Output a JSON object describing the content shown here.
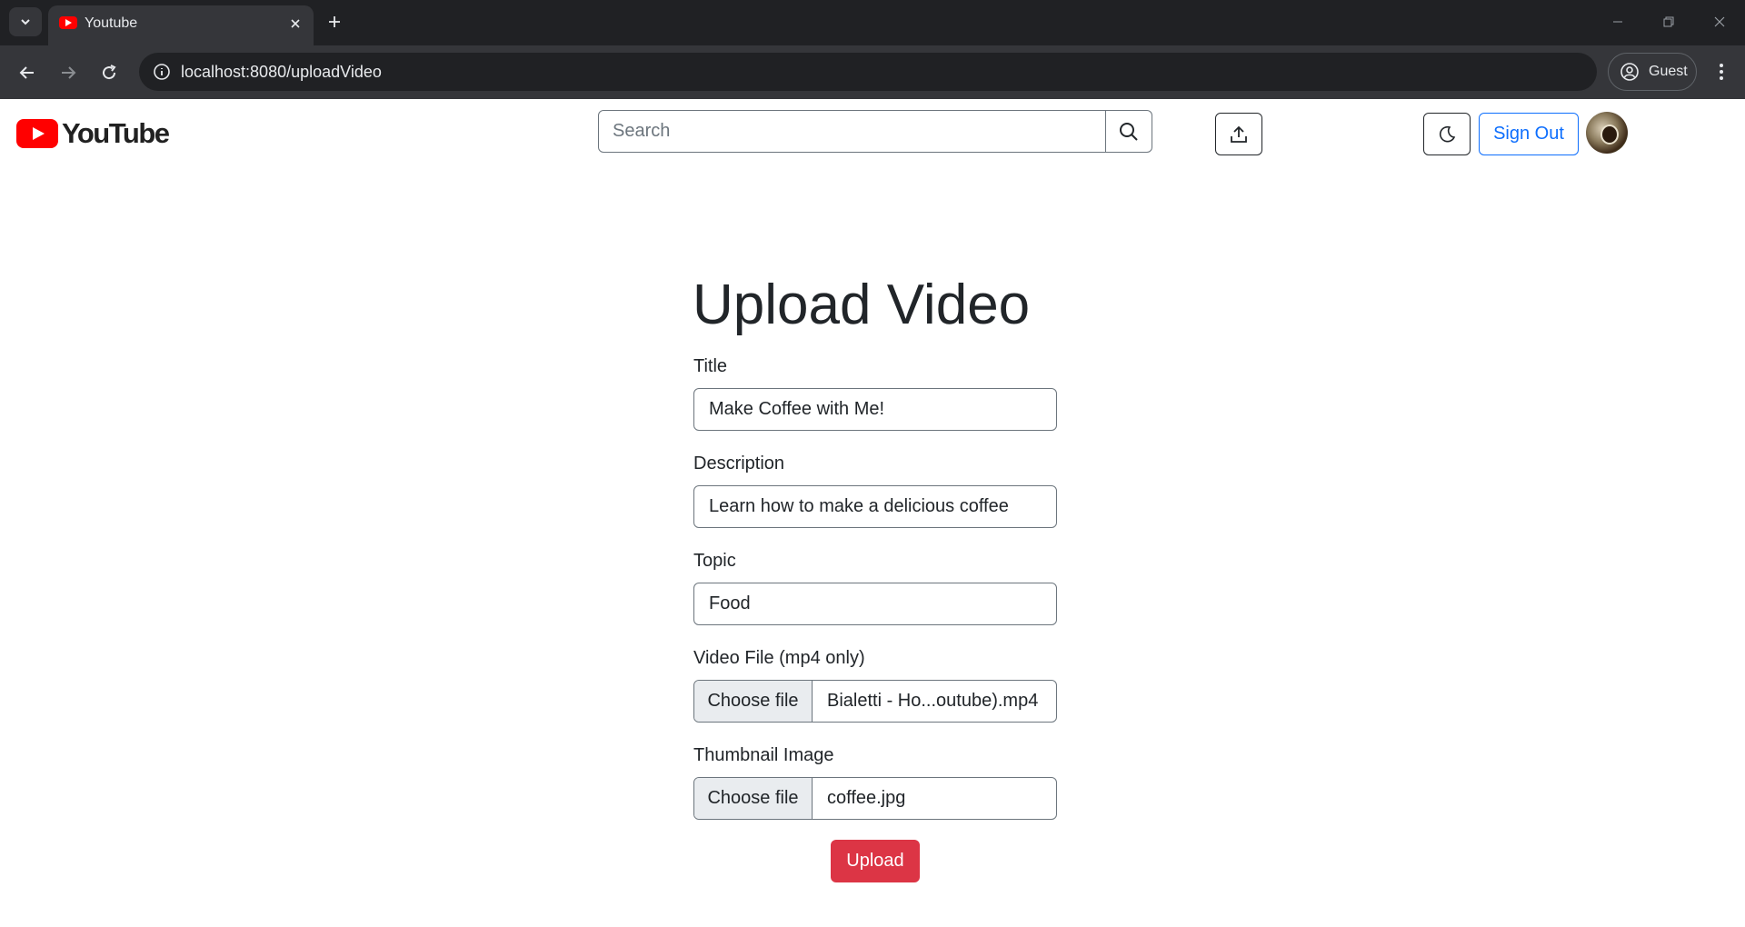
{
  "browser": {
    "tab_title": "Youtube",
    "url": "localhost:8080/uploadVideo",
    "profile_label": "Guest"
  },
  "header": {
    "logo_text": "YouTube",
    "search_placeholder": "Search",
    "signout_label": "Sign Out"
  },
  "form": {
    "heading": "Upload Video",
    "title_label": "Title",
    "title_value": "Make Coffee with Me!",
    "description_label": "Description",
    "description_value": "Learn how to make a delicious coffee",
    "topic_label": "Topic",
    "topic_value": "Food",
    "video_label": "Video File (mp4 only)",
    "video_button": "Choose file",
    "video_filename": "Bialetti - Ho...outube).mp4",
    "thumb_label": "Thumbnail Image",
    "thumb_button": "Choose file",
    "thumb_filename": "coffee.jpg",
    "submit_label": "Upload"
  },
  "colors": {
    "brand_red": "#ff0000",
    "primary_blue": "#0d6efd",
    "danger_red": "#dc3545",
    "chrome_dark": "#202124"
  },
  "icons": [
    "tab-search-icon",
    "youtube-favicon",
    "close-icon",
    "plus-icon",
    "back-arrow-icon",
    "forward-arrow-icon",
    "reload-icon",
    "info-icon",
    "profile-icon",
    "kebab-menu-icon",
    "search-icon",
    "upload-icon",
    "moon-icon"
  ]
}
